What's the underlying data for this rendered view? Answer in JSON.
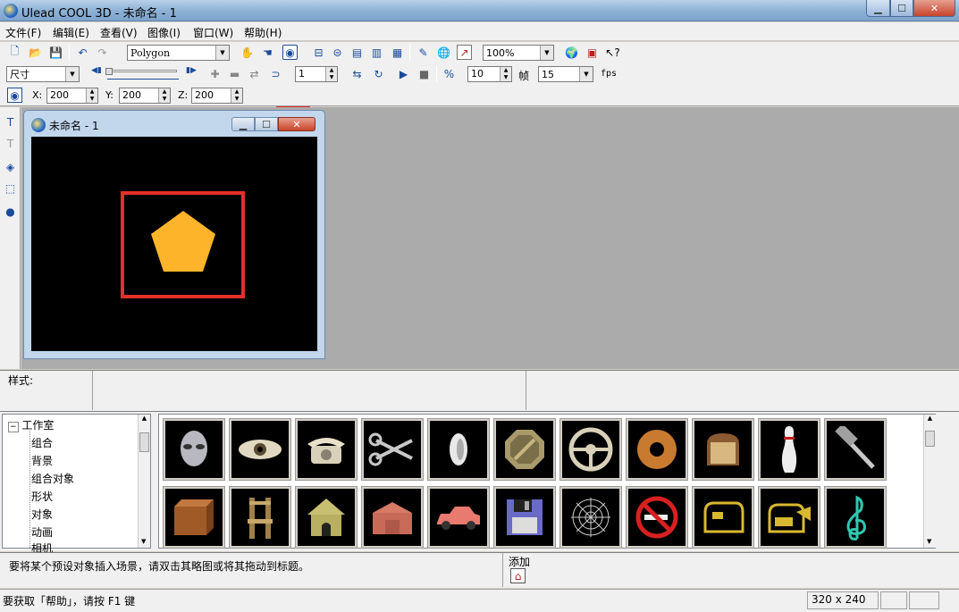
{
  "app": {
    "title": "Ulead COOL 3D - 未命名 - 1"
  },
  "menu": [
    "文件(F)",
    "编辑(E)",
    "查看(V)",
    "图像(I)",
    "窗口(W)",
    "帮助(H)"
  ],
  "toolbar1": {
    "object_type": "Polygon",
    "zoom": "100%"
  },
  "toolbar2": {
    "attribute": "尺寸",
    "frame": "1",
    "frames_total": "10",
    "frame_label": "帧",
    "fps_value": "15",
    "fps_label": "fps"
  },
  "toolbar3": {
    "x_label": "X:",
    "x_value": "200",
    "y_label": "Y:",
    "y_value": "200",
    "z_label": "Z:",
    "z_value": "200"
  },
  "document": {
    "title": "未命名 - 1"
  },
  "style_panel": {
    "label": "样式:"
  },
  "library": {
    "root": "工作室",
    "items": [
      "组合",
      "背景",
      "组合对象",
      "形状",
      "对象",
      "动画",
      "相机"
    ],
    "thumbnails_row1": [
      "alien",
      "eye",
      "telephone",
      "scissors",
      "ring",
      "octagon",
      "steering-wheel",
      "donut",
      "bread",
      "bowling-pin",
      "hammer"
    ],
    "thumbnails_row2": [
      "crate",
      "chair",
      "house",
      "barn",
      "car",
      "floppy-disk",
      "spider-web",
      "no-smoking",
      "mailbox",
      "mailbox-open",
      "treble-clef"
    ]
  },
  "hint": {
    "text": "要将某个预设对象插入场景，请双击其略图或将其拖动到标题。",
    "add_label": "添加"
  },
  "status": {
    "text": "要获取「帮助」，请按 F1 键",
    "size": "320 x 240"
  },
  "colors": {
    "pentagon": "#fdb42a",
    "highlight": "#e3302a"
  }
}
